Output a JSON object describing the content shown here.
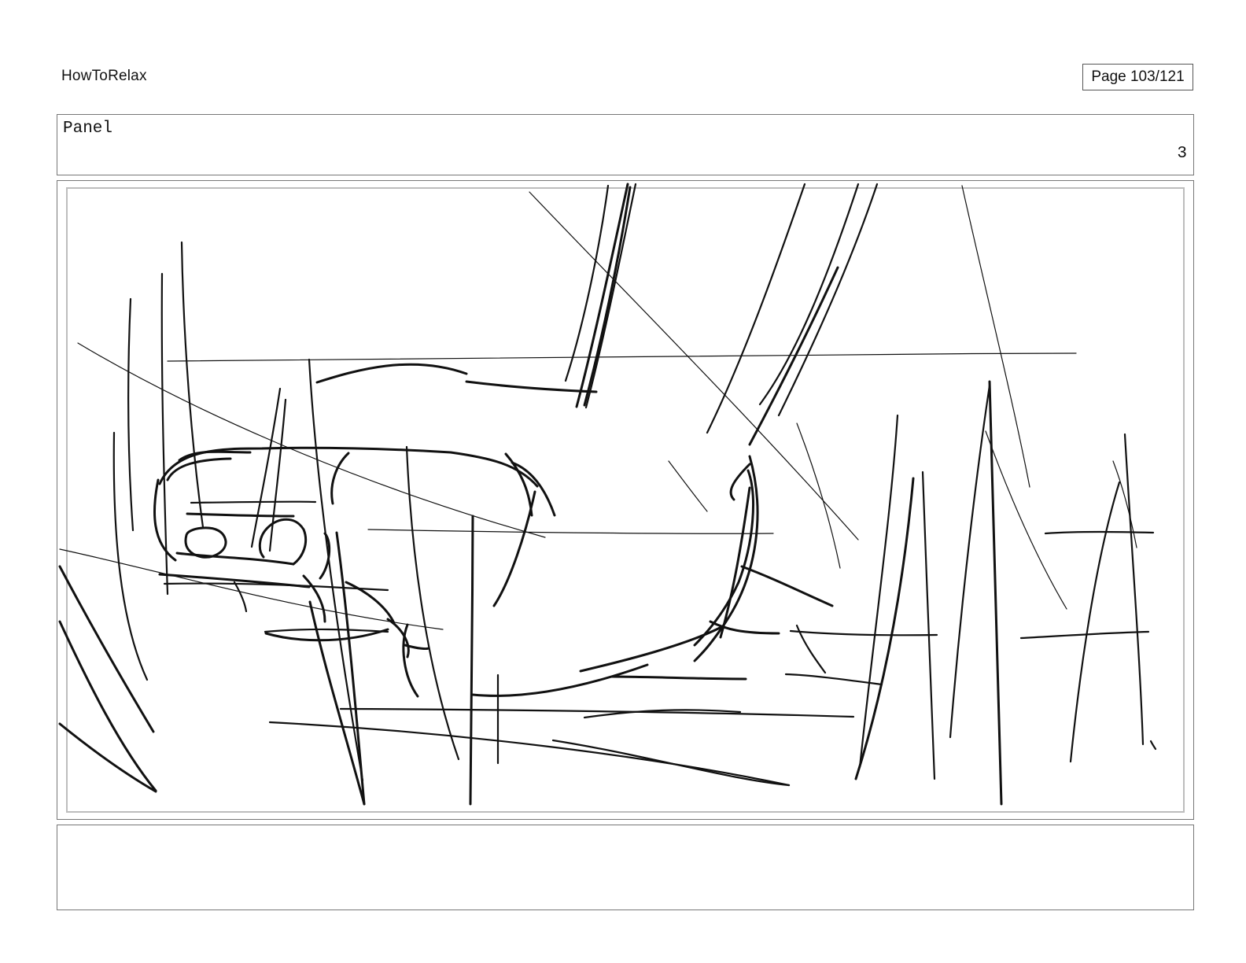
{
  "header": {
    "title": "HowToRelax",
    "page_counter": "Page 103/121"
  },
  "panel": {
    "label": "Panel",
    "number": "3"
  },
  "notes": {
    "text": ""
  }
}
